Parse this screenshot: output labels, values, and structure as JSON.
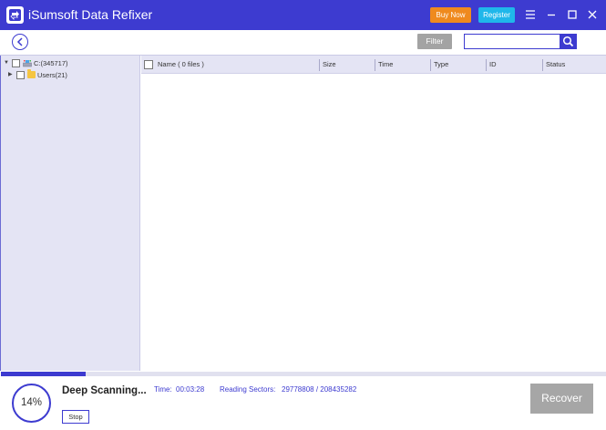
{
  "app": {
    "title": "iSumsoft Data Refixer",
    "logo_icon": "app-logo-icon"
  },
  "titlebar": {
    "buy_now_label": "Buy Now",
    "register_label": "Register",
    "icons": [
      "menu-icon",
      "minimize-icon",
      "maximize-icon",
      "close-icon"
    ]
  },
  "toolbar": {
    "back_icon": "back-arrow-icon",
    "filter_label": "Filter",
    "search_value": "",
    "search_placeholder": "",
    "search_icon": "search-icon"
  },
  "tree": {
    "items": [
      {
        "label": "C:(345717)",
        "expanded": true,
        "checked": false,
        "icon": "drive-icon"
      },
      {
        "label": "Users(21)",
        "expanded": false,
        "checked": false,
        "icon": "folder-icon"
      }
    ]
  },
  "file_list": {
    "columns": [
      "Name ( 0 files )",
      "Size",
      "Time",
      "Type",
      "ID",
      "Status"
    ],
    "rows": []
  },
  "status": {
    "percent_label": "14%",
    "progress": 0.14,
    "scan_title": "Deep Scanning...",
    "stop_label": "Stop",
    "time_label": "Time:",
    "time_value": "00:03:28",
    "sectors_label": "Reading Sectors:",
    "sectors_value": "29778808 / 208435282",
    "recover_label": "Recover"
  },
  "colors": {
    "accent": "#3d3bd0",
    "buy_now": "#ef8a1e",
    "register": "#1fb7ea",
    "disabled": "#a6a6a6",
    "panel": "#e4e4f4"
  }
}
